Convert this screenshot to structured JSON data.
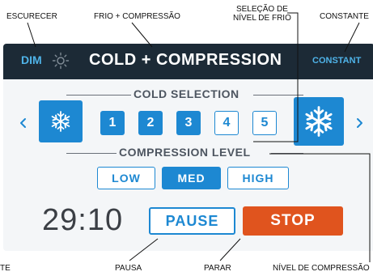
{
  "callouts": {
    "dim": "ESCURECER",
    "mode": "FRIO + COMPRESSÃO",
    "cold_level_line1": "SELEÇÃO DE",
    "cold_level_line2": "NÍVEL DE FRIO",
    "constant": "CONSTANTE",
    "left_cut": "TE",
    "pause": "PAUSA",
    "stop": "PARAR",
    "compression_level": "NÍVEL DE COMPRESSÃO"
  },
  "header": {
    "dim_label": "DIM",
    "title": "COLD + COMPRESSION",
    "constant_label": "CONSTANT"
  },
  "cold": {
    "section_label": "COLD SELECTION",
    "levels": [
      "1",
      "2",
      "3",
      "4",
      "5"
    ],
    "active_up_to": 3
  },
  "compression": {
    "section_label": "COMPRESSION LEVEL",
    "options": [
      "LOW",
      "MED",
      "HIGH"
    ],
    "selected": "MED"
  },
  "controls": {
    "timer": "29:10",
    "pause_label": "PAUSE",
    "stop_label": "STOP"
  },
  "colors": {
    "accent": "#1d88d2",
    "header_bg": "#1c2a36",
    "stop": "#e0541e"
  }
}
